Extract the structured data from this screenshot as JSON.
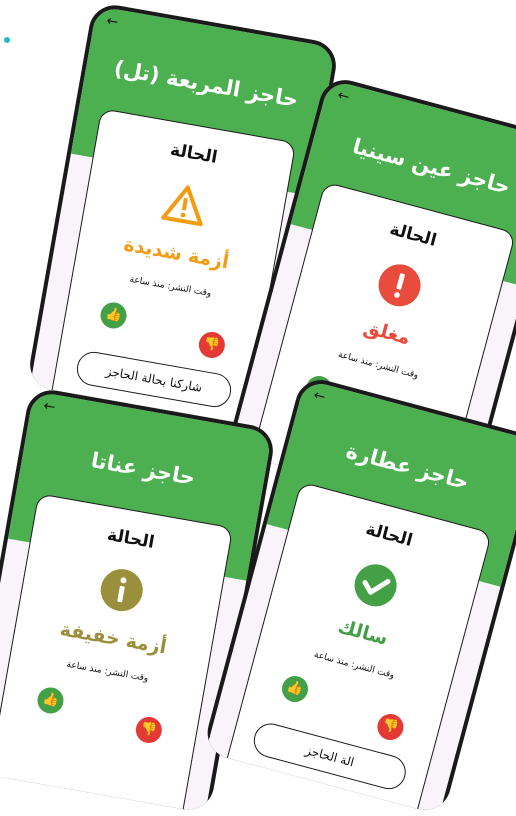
{
  "colors": {
    "header_green": "#4caf50",
    "warning_orange": "#f39c12",
    "closed_red": "#e74c3c",
    "mild_olive": "#9a8f3c",
    "open_green": "#43a047",
    "dislike_red": "#e53935",
    "like_green": "#43a047",
    "accent_dot": "#20b8c8"
  },
  "phones": [
    {
      "title": "حاجز المربعة (تل)",
      "status_label": "الحالة",
      "status_icon": "warning-triangle-icon",
      "status_text": "أزمة شديدة",
      "time_text": "وقت النشر: منذ ساعة",
      "share_label": "شاركنا بحالة الحاجز"
    },
    {
      "title": "حاجز عين سينيا",
      "status_label": "الحالة",
      "status_icon": "exclamation-circle-icon",
      "status_text": "مغلق",
      "time_text": "وقت النشر: منذ ساعة",
      "share_label": ""
    },
    {
      "title": "حاجز عناتا",
      "status_label": "الحالة",
      "status_icon": "info-circle-icon",
      "status_text": "أزمة خفيفة",
      "time_text": "وقت النشر: منذ ساعة",
      "share_label": ""
    },
    {
      "title": "حاجز عطارة",
      "status_label": "الحالة",
      "status_icon": "check-circle-icon",
      "status_text": "سالك",
      "time_text": "وقت النشر: منذ ساعة",
      "share_label": "الة الحاجز"
    }
  ]
}
